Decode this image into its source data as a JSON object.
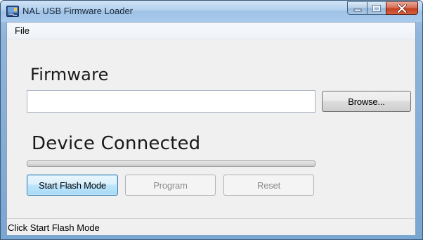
{
  "window": {
    "title": "NAL USB Firmware Loader",
    "icon": "usb-loader-app-icon"
  },
  "menu": {
    "items": [
      {
        "label": "File"
      }
    ]
  },
  "firmware": {
    "heading": "Firmware",
    "path_value": "",
    "browse_label": "Browse..."
  },
  "device": {
    "heading": "Device Connected",
    "progress_fraction": 0
  },
  "actions": {
    "start_flash_label": "Start Flash Mode",
    "program_label": "Program",
    "reset_label": "Reset"
  },
  "status": {
    "text": "Click Start Flash Mode"
  },
  "colors": {
    "titlebar": "#a9cbec",
    "close_button": "#c3401f",
    "focus_border": "#3c7fb1"
  }
}
